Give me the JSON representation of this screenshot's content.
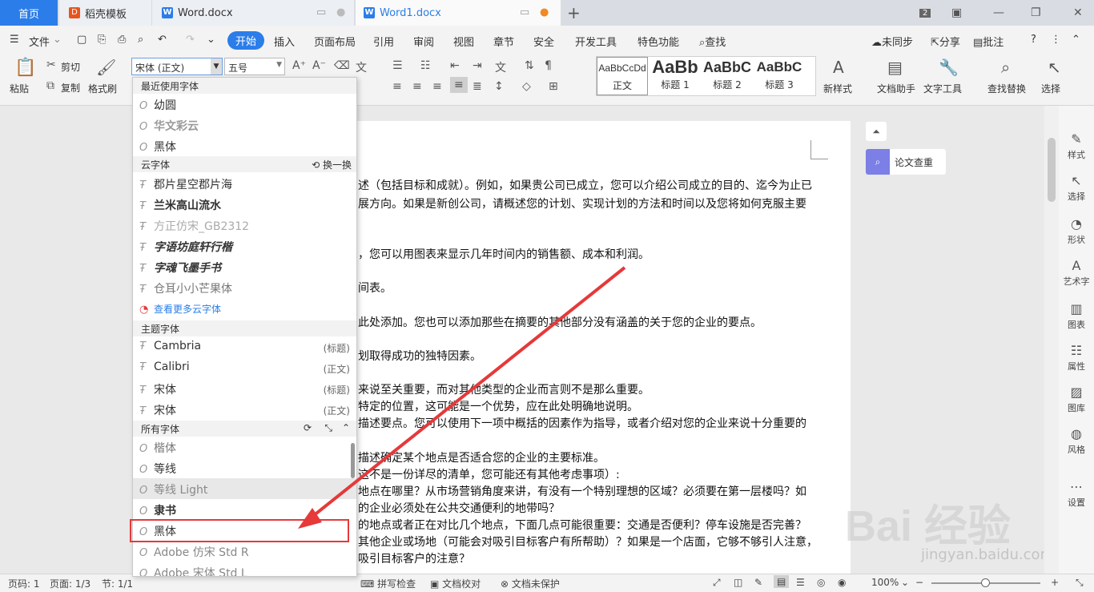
{
  "tabs": {
    "home": "首页",
    "tab1": "稻壳模板",
    "tab2": "Word.docx",
    "tab3": "Word1.docx",
    "add": "+",
    "count": "2"
  },
  "menu": {
    "file": "文件",
    "items": [
      "开始",
      "插入",
      "页面布局",
      "引用",
      "审阅",
      "视图",
      "章节",
      "安全",
      "开发工具",
      "特色功能"
    ],
    "search": "查找",
    "unsync": "未同步",
    "share": "分享",
    "annotate": "批注",
    "help": "?"
  },
  "ribbon": {
    "paste": "粘贴",
    "cut": "剪切",
    "copy": "复制",
    "format_painter": "格式刷",
    "font": "宋体 (正文)",
    "size": "五号",
    "styles": [
      {
        "sample": "AaBbCcDd",
        "label": "正文"
      },
      {
        "sample": "AaBb",
        "label": "标题 1"
      },
      {
        "sample": "AaBbC",
        "label": "标题 2"
      },
      {
        "sample": "AaBbC",
        "label": "标题 3"
      }
    ],
    "new_style": "新样式",
    "doc_assist": "文档助手",
    "text_tools": "文字工具",
    "find_replace": "查找替换",
    "select": "选择"
  },
  "font_dropdown": {
    "recent_header": "最近使用字体",
    "recent": [
      "幼圆",
      "华文彩云",
      "黑体"
    ],
    "cloud_header": "云字体",
    "cloud_switch": "换一换",
    "cloud": [
      "郡片星空郡片海",
      "兰米高山流水",
      "方正仿宋_GB2312",
      "字语坊庭轩行楷",
      "字魂飞墨手书",
      "仓耳小小芒果体"
    ],
    "more_cloud": "查看更多云字体",
    "theme_header": "主题字体",
    "theme": [
      {
        "name": "Cambria",
        "hint": "(标题)"
      },
      {
        "name": "Calibri",
        "hint": "(正文)"
      },
      {
        "name": "宋体",
        "hint": "(标题)"
      },
      {
        "name": "宋体",
        "hint": "(正文)"
      }
    ],
    "all_header": "所有字体",
    "all": [
      "楷体",
      "等线",
      "等线 Light",
      "隶书",
      "黑体",
      "Adobe 仿宋 Std R",
      "Adobe 宋体 Std L"
    ]
  },
  "document": {
    "lines": [
      "述（包括目标和成就）。例如，如果贵公司已成立，您可以介绍公司成立的目的、迄今为止已",
      "展方向。如果是新创公司，请概述您的计划、实现计划的方法和时间以及您将如何克服主要",
      "，您可以用图表来显示几年时间内的销售额、成本和利润。",
      "间表。",
      "此处添加。您也可以添加那些在摘要的其他部分没有涵盖的关于您的企业的要点。",
      "划取得成功的独特因素。",
      "来说至关重要，而对其他类型的企业而言则不是那么重要。",
      "特定的位置，这可能是一个优势，应在此处明确地说明。",
      "描述要点。您可以使用下一项中概括的因素作为指导，或者介绍对您的企业来说十分重要的",
      "描述确定某个地点是否适合您的企业的主要标准。",
      "这不是一份详尽的清单，您可能还有其他考虑事项）:",
      "地点在哪里？从市场营销角度来讲，有没有一个特别理想的区域？必须要在第一层楼吗？如",
      "的企业必须处在公共交通便利的地带吗？",
      "的地点或者正在对比几个地点，下面几点可能很重要：交通是否便利？停车设施是否完善？",
      "其他企业或场地（可能会对吸引目标客户有所帮助）？如果是一个店面，它够不够引人注意，",
      "吸引目标客户的注意？"
    ]
  },
  "side_panel": {
    "paper_check": "论文查重",
    "items": [
      "样式",
      "选择",
      "形状",
      "艺术字",
      "图表",
      "属性",
      "图库",
      "风格",
      "设置"
    ]
  },
  "status": {
    "page_num": "页码: 1",
    "pages": "页面: 1/3",
    "section": "节: 1/1",
    "spell": "拼写检查",
    "proof": "文档校对",
    "protect": "文档未保护",
    "zoom": "100%"
  },
  "watermark": {
    "logo": "Bai经验",
    "url": "jingyan.baidu.com"
  },
  "colors": {
    "accent": "#2b7de9",
    "highlight_box": "#e5393a",
    "arrow": "#e5393a"
  }
}
